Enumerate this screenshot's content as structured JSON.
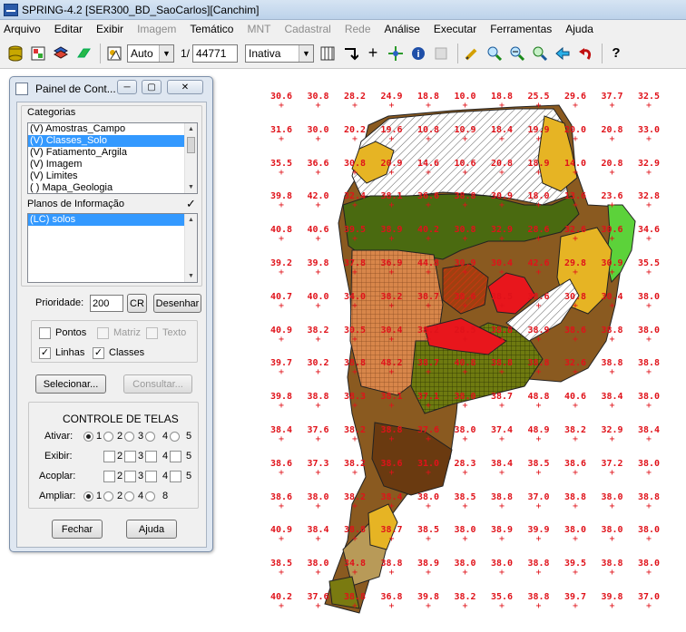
{
  "window": {
    "title": "SPRING-4.2 [SER300_BD_SaoCarlos][Canchim]"
  },
  "menu": [
    {
      "label": "Arquivo",
      "enabled": true
    },
    {
      "label": "Editar",
      "enabled": true
    },
    {
      "label": "Exibir",
      "enabled": true
    },
    {
      "label": "Imagem",
      "enabled": false
    },
    {
      "label": "Temático",
      "enabled": true
    },
    {
      "label": "MNT",
      "enabled": false
    },
    {
      "label": "Cadastral",
      "enabled": false
    },
    {
      "label": "Rede",
      "enabled": false
    },
    {
      "label": "Análise",
      "enabled": true
    },
    {
      "label": "Executar",
      "enabled": true
    },
    {
      "label": "Ferramentas",
      "enabled": true
    },
    {
      "label": "Ajuda",
      "enabled": true
    }
  ],
  "toolbar": {
    "scale_mode": "Auto",
    "scale_prefix": "1/",
    "scale_value": "44771",
    "layer_mode": "Inativa",
    "help_glyph": "?",
    "info_glyph": "i"
  },
  "panel": {
    "title": "Painel de Cont...",
    "categories_label": "Categorias",
    "categories": [
      {
        "label": "(V) Amostras_Campo",
        "selected": false
      },
      {
        "label": "(V) Classes_Solo",
        "selected": true
      },
      {
        "label": "(V) Fatiamento_Argila",
        "selected": false
      },
      {
        "label": "(V) Imagem",
        "selected": false
      },
      {
        "label": "(V) Limites",
        "selected": false
      },
      {
        "label": "( ) Mapa_Geologia",
        "selected": false
      }
    ],
    "planos_label": "Planos de Informação",
    "planos": [
      {
        "label": "(LC) solos",
        "selected": true
      }
    ],
    "prioridade_label": "Prioridade:",
    "prioridade_value": "200",
    "cr_label": "CR",
    "desenhar_label": "Desenhar",
    "pontos_label": "Pontos",
    "matriz_label": "Matriz",
    "texto_label": "Texto",
    "linhas_label": "Linhas",
    "classes_label": "Classes",
    "check_mark": "✓",
    "selecionar_label": "Selecionar...",
    "consultar_label": "Consultar...",
    "controle_label": "CONTROLE DE TELAS",
    "ativar_label": "Ativar:",
    "exibir_label": "Exibir:",
    "acoplar_label": "Acoplar:",
    "ampliar_label": "Ampliar:",
    "num_1": "1",
    "num_2": "2",
    "num_3": "3",
    "num_4": "4",
    "num_5": "5",
    "num_8": "8",
    "fechar_label": "Fechar",
    "ajuda_label": "Ajuda"
  },
  "map_grid": [
    [
      "30.6",
      "30.8",
      "28.2",
      "24.9",
      "18.8",
      "10.0",
      "18.8",
      "25.5",
      "29.6",
      "37.7",
      "32.5"
    ],
    [
      "31.6",
      "30.0",
      "20.2",
      "19.6",
      "10.8",
      "10.9",
      "18.4",
      "19.9",
      "20.0",
      "20.8",
      "33.0"
    ],
    [
      "35.5",
      "36.6",
      "30.8",
      "20.9",
      "14.6",
      "10.6",
      "20.8",
      "18.9",
      "14.0",
      "20.8",
      "32.9"
    ],
    [
      "39.8",
      "42.0",
      "32.4",
      "38.1",
      "36.6",
      "38.8",
      "30.9",
      "18.0",
      "13.6",
      "23.6",
      "32.8"
    ],
    [
      "40.8",
      "40.6",
      "39.5",
      "38.9",
      "40.2",
      "30.8",
      "32.9",
      "28.6",
      "32.6",
      "30.6",
      "34.6"
    ],
    [
      "39.2",
      "39.8",
      "37.8",
      "36.9",
      "44.8",
      "30.9",
      "30.4",
      "42.6",
      "29.8",
      "30.9",
      "35.5"
    ],
    [
      "40.7",
      "40.0",
      "34.0",
      "38.2",
      "38.7",
      "38.6",
      "38.5",
      "38.6",
      "30.8",
      "30.4",
      "38.0"
    ],
    [
      "40.9",
      "38.2",
      "30.5",
      "30.4",
      "38.2",
      "28.5",
      "38.8",
      "38.9",
      "38.6",
      "38.8",
      "38.0"
    ],
    [
      "39.7",
      "30.2",
      "38.8",
      "48.2",
      "38.7",
      "40.8",
      "38.8",
      "38.8",
      "32.6",
      "38.8",
      "38.8"
    ],
    [
      "39.8",
      "38.8",
      "38.3",
      "38.1",
      "37.1",
      "38.0",
      "38.7",
      "48.8",
      "40.6",
      "38.4",
      "38.0"
    ],
    [
      "38.4",
      "37.6",
      "38.2",
      "38.8",
      "37.6",
      "38.0",
      "37.4",
      "48.9",
      "38.2",
      "32.9",
      "38.4"
    ],
    [
      "38.6",
      "37.3",
      "38.2",
      "38.6",
      "31.0",
      "28.3",
      "38.4",
      "38.5",
      "38.6",
      "37.2",
      "38.0"
    ],
    [
      "38.6",
      "38.0",
      "38.2",
      "38.4",
      "38.0",
      "38.5",
      "38.8",
      "37.0",
      "38.8",
      "38.0",
      "38.8"
    ],
    [
      "40.9",
      "38.4",
      "38.8",
      "38.7",
      "38.5",
      "38.0",
      "38.9",
      "39.9",
      "38.0",
      "38.0",
      "38.0"
    ],
    [
      "38.5",
      "38.0",
      "34.8",
      "38.8",
      "38.9",
      "38.0",
      "38.0",
      "38.8",
      "39.5",
      "38.8",
      "38.0"
    ],
    [
      "40.2",
      "37.6",
      "38.8",
      "36.8",
      "39.8",
      "38.2",
      "35.6",
      "38.8",
      "39.7",
      "39.8",
      "37.0"
    ]
  ]
}
